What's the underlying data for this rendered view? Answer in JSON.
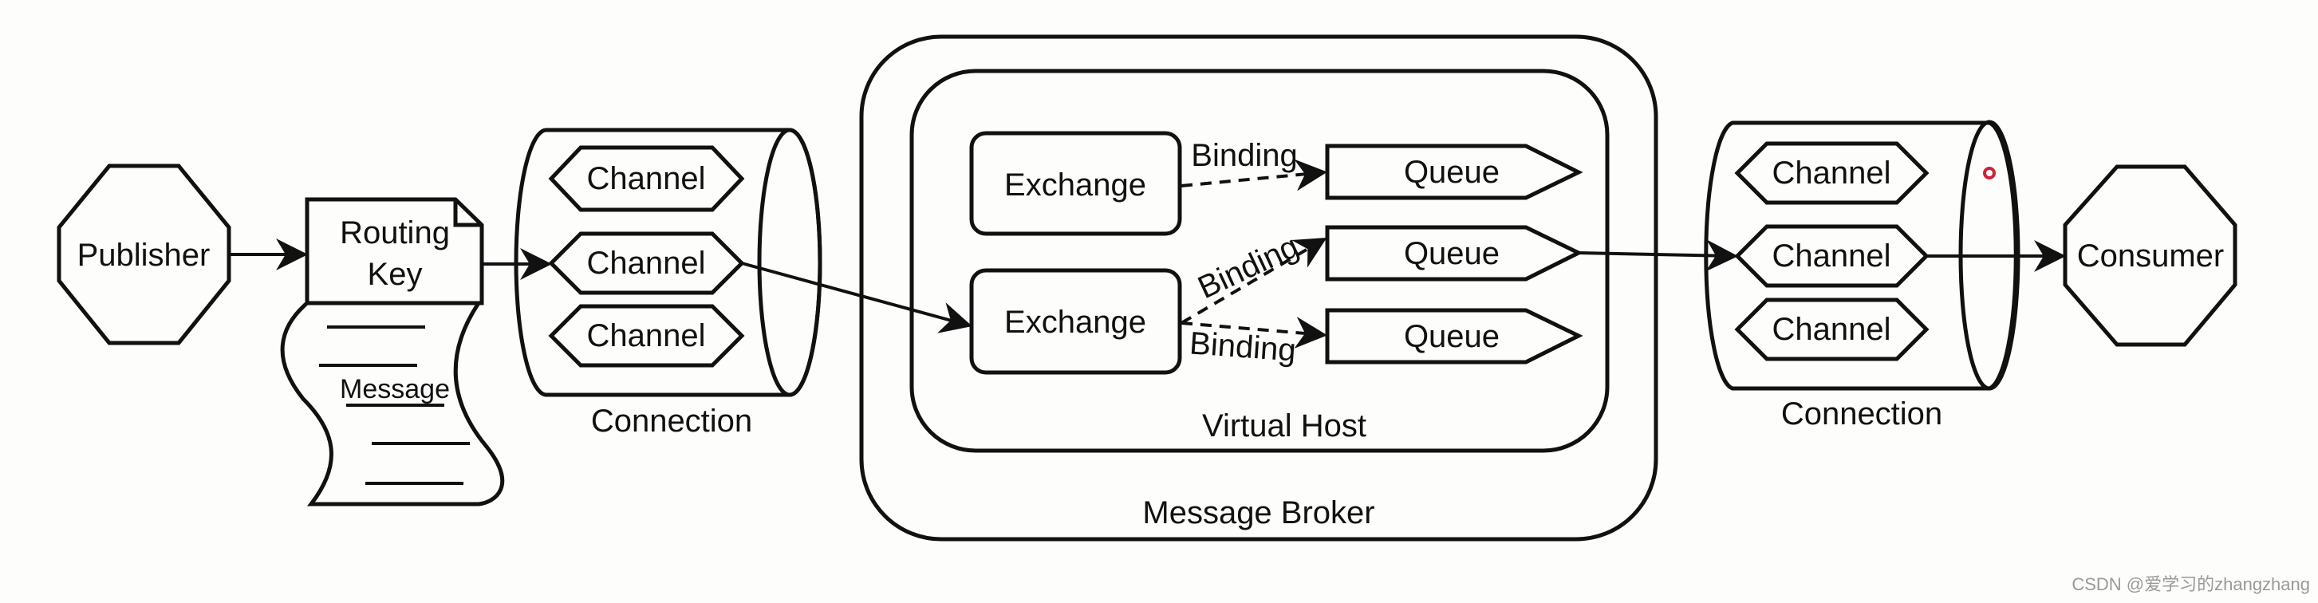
{
  "publisher": "Publisher",
  "routing_key": [
    "Routing",
    "Key"
  ],
  "message": "Message",
  "connection_left": {
    "label": "Connection",
    "channels": [
      "Channel",
      "Channel",
      "Channel"
    ]
  },
  "broker": {
    "label": "Message Broker",
    "virtual_host": {
      "label": "Virtual Host",
      "exchanges": [
        "Exchange",
        "Exchange"
      ],
      "bindings": [
        "Binding",
        "Binding",
        "Binding"
      ],
      "queues": [
        "Queue",
        "Queue",
        "Queue"
      ]
    }
  },
  "connection_right": {
    "label": "Connection",
    "channels": [
      "Channel",
      "Channel",
      "Channel"
    ]
  },
  "consumer": "Consumer",
  "watermark": "CSDN @爱学习的zhangzhang",
  "colors": {
    "stroke": "#111111",
    "background": "#fdfdfb",
    "cursor_dot": "#d0203a"
  }
}
